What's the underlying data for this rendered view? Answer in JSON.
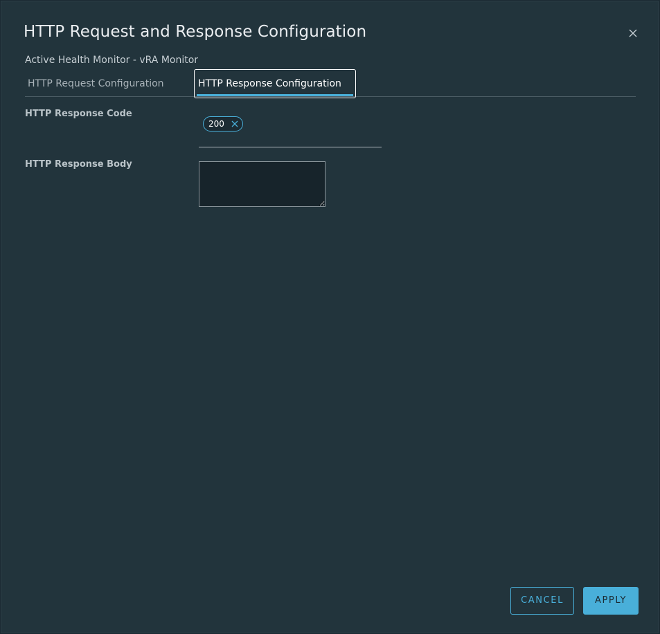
{
  "modal": {
    "title": "HTTP Request and Response Configuration",
    "subtitle": "Active Health Monitor - vRA Monitor"
  },
  "tabs": [
    {
      "label": "HTTP Request Configuration",
      "active": false
    },
    {
      "label": "HTTP Response Configuration",
      "active": true
    }
  ],
  "form": {
    "response_code": {
      "label": "HTTP Response Code",
      "tags": [
        "200"
      ]
    },
    "response_body": {
      "label": "HTTP Response Body",
      "value": ""
    }
  },
  "footer": {
    "cancel_label": "CANCEL",
    "apply_label": "APPLY"
  },
  "colors": {
    "accent": "#49afd9",
    "background": "#22343c"
  },
  "icons": {
    "close": "close-icon",
    "tag_remove": "close-icon"
  }
}
